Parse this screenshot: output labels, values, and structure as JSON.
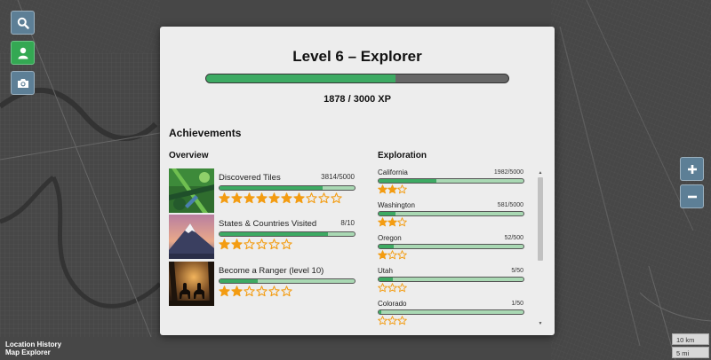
{
  "app": {
    "brand_line1": "Location History",
    "brand_line2": "Map Explorer"
  },
  "toolbar": [
    {
      "icon": "search-icon"
    },
    {
      "icon": "user-icon"
    },
    {
      "icon": "camera-icon"
    }
  ],
  "zoom": {
    "in_icon": "plus-icon",
    "out_icon": "minus-icon"
  },
  "scale": {
    "km": "10 km",
    "mi": "5 mi"
  },
  "level": {
    "title": "Level 6 – Explorer",
    "xp_text": "1878 / 3000 XP",
    "xp_progress": 0.626
  },
  "achievements": {
    "title": "Achievements",
    "overview_title": "Overview",
    "exploration_title": "Exploration",
    "overview": [
      {
        "label": "Discovered Tiles",
        "count": "3814/5000",
        "progress": 0.763,
        "stars_filled": 7,
        "stars_total": 10
      },
      {
        "label": "States & Countries Visited",
        "count": "8/10",
        "progress": 0.8,
        "stars_filled": 2,
        "stars_total": 6
      },
      {
        "label": "Become a Ranger (level 10)",
        "count": "",
        "progress": 0.28,
        "stars_filled": 2,
        "stars_total": 6
      }
    ],
    "exploration": [
      {
        "name": "California",
        "count": "1982/5000",
        "progress": 0.396,
        "stars_filled": 2,
        "stars_total": 3
      },
      {
        "name": "Washington",
        "count": "581/5000",
        "progress": 0.116,
        "stars_filled": 2,
        "stars_total": 3
      },
      {
        "name": "Oregon",
        "count": "52/500",
        "progress": 0.104,
        "stars_filled": 1,
        "stars_total": 3
      },
      {
        "name": "Utah",
        "count": "5/50",
        "progress": 0.1,
        "stars_filled": 0,
        "stars_total": 3
      },
      {
        "name": "Colorado",
        "count": "1/50",
        "progress": 0.02,
        "stars_filled": 0,
        "stars_total": 3
      }
    ]
  },
  "colors": {
    "progress": "#3daa63",
    "progress_bg": "#a9d8b3",
    "star": "#f39c12",
    "button": "#5d7f96",
    "button_active": "#34a853"
  }
}
